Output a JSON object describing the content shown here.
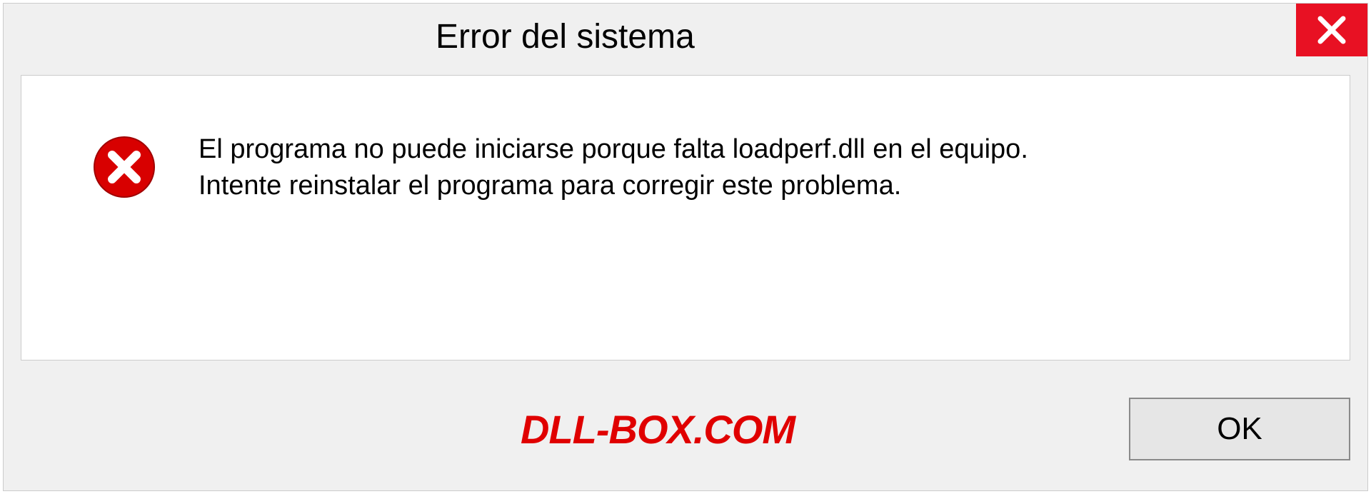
{
  "dialog": {
    "title": "Error del sistema",
    "message_line1": "El programa no puede iniciarse porque falta loadperf.dll en el equipo.",
    "message_line2": "Intente reinstalar el programa para corregir este problema.",
    "ok_label": "OK"
  },
  "watermark": "DLL-BOX.COM",
  "colors": {
    "close_button": "#e81123",
    "error_icon": "#d80000",
    "watermark": "#e00000"
  }
}
